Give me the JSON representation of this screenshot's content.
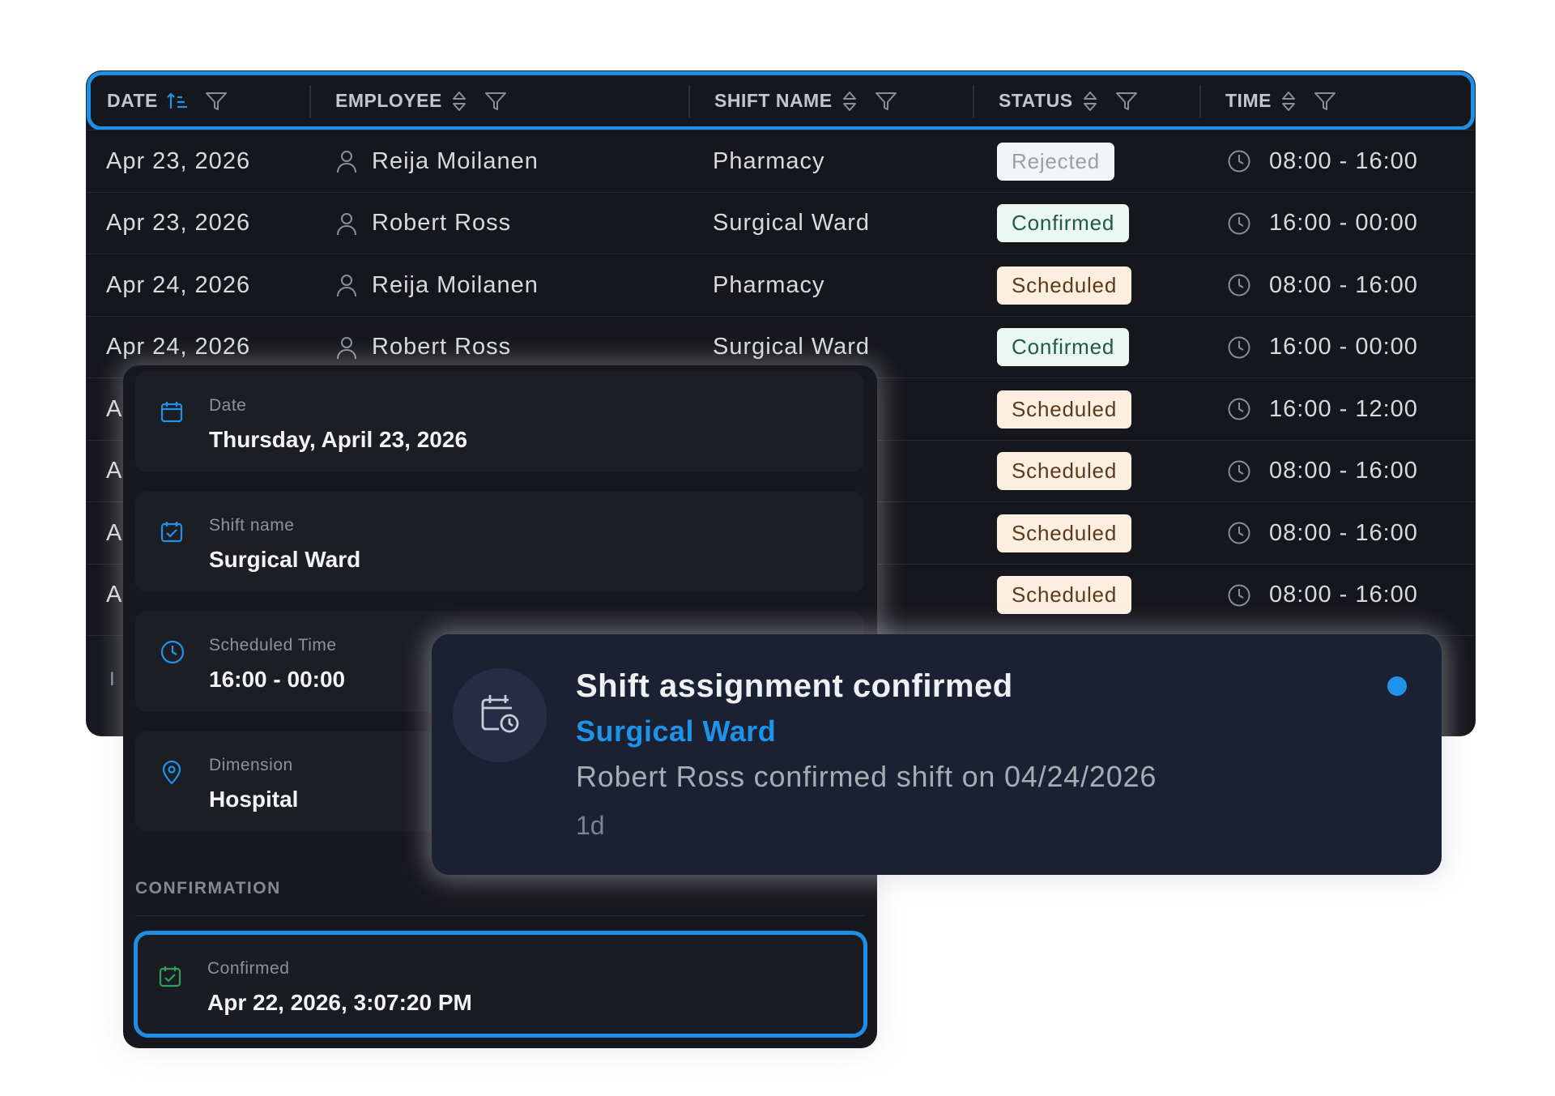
{
  "table": {
    "headers": {
      "date": "DATE",
      "employee": "EMPLOYEE",
      "shift_name": "SHIFT NAME",
      "status": "STATUS",
      "time": "TIME"
    },
    "rows": [
      {
        "date": "Apr 23, 2026",
        "employee": "Reija Moilanen",
        "shift": "Pharmacy",
        "status": "Rejected",
        "time": "08:00 - 16:00"
      },
      {
        "date": "Apr 23, 2026",
        "employee": "Robert Ross",
        "shift": "Surgical Ward",
        "status": "Confirmed",
        "time": "16:00 - 00:00"
      },
      {
        "date": "Apr 24, 2026",
        "employee": "Reija Moilanen",
        "shift": "Pharmacy",
        "status": "Scheduled",
        "time": "08:00 - 16:00"
      },
      {
        "date": "Apr 24, 2026",
        "employee": "Robert Ross",
        "shift": "Surgical Ward",
        "status": "Confirmed",
        "time": "16:00 - 00:00"
      },
      {
        "date": "A",
        "employee": "",
        "shift": "",
        "status": "Scheduled",
        "time": "16:00 - 12:00"
      },
      {
        "date": "A",
        "employee": "",
        "shift": "",
        "status": "Scheduled",
        "time": "08:00 - 16:00"
      },
      {
        "date": "A",
        "employee": "",
        "shift": "",
        "status": "Scheduled",
        "time": "08:00 - 16:00"
      },
      {
        "date": "A",
        "employee": "",
        "shift": "",
        "status": "Scheduled",
        "time": "08:00 - 16:00"
      }
    ],
    "footer_text": "I"
  },
  "detail": {
    "date_label": "Date",
    "date_value": "Thursday, April 23, 2026",
    "shift_label": "Shift name",
    "shift_value": "Surgical Ward",
    "time_label": "Scheduled Time",
    "time_value": "16:00 - 00:00",
    "dimension_label": "Dimension",
    "dimension_value": "Hospital",
    "section_title": "CONFIRMATION",
    "confirmed_label": "Confirmed",
    "confirmed_value": "Apr 22, 2026, 3:07:20 PM"
  },
  "notification": {
    "title": "Shift assignment confirmed",
    "subtitle": "Surgical Ward",
    "body": "Robert Ross confirmed shift on 04/24/2026",
    "time": "1d",
    "accent_color": "#1e93ea"
  },
  "colors": {
    "accent_blue": "#1e8fe6",
    "panel_bg": "#16171c",
    "rejected_bg": "#f3f4f6",
    "confirmed_bg": "#eaf7f3",
    "scheduled_bg": "#fdefe0",
    "confirmed_check": "#2ea05e"
  },
  "icons": {
    "date_sort": "sort-ascending-icon",
    "column_sort": "sort-updown-icon",
    "filter": "filter-icon",
    "employee": "person-icon",
    "time": "clock-icon",
    "detail_date": "calendar-icon",
    "detail_shift": "calendar-check-icon",
    "detail_time": "clock-icon",
    "detail_dimension": "location-pin-icon",
    "confirmed": "calendar-check-icon",
    "notification": "calendar-clock-icon"
  }
}
